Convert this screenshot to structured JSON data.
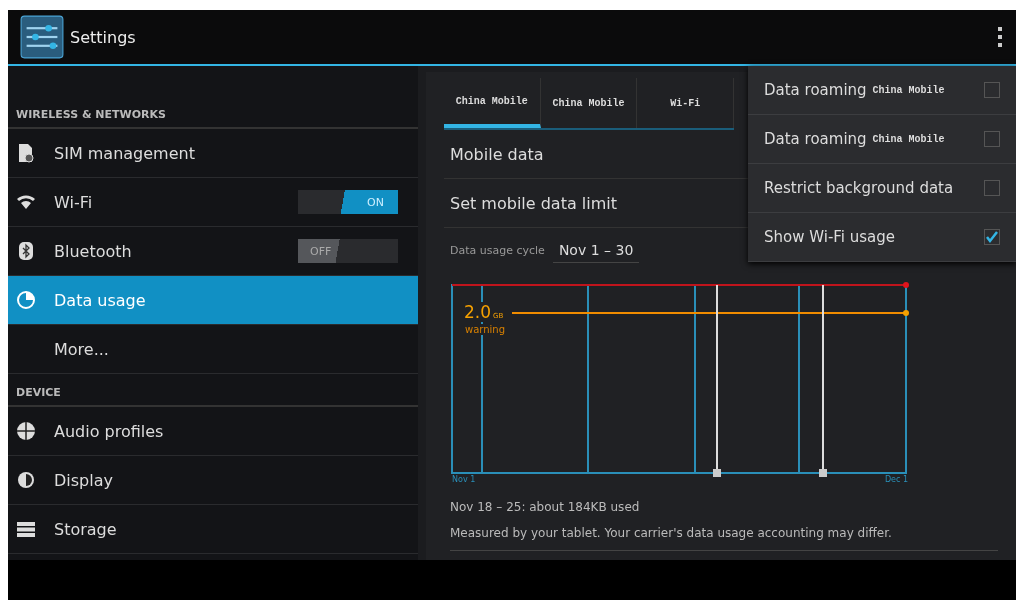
{
  "action_bar": {
    "title": "Settings"
  },
  "sidebar": {
    "sections": [
      {
        "header": "WIRELESS & NETWORKS",
        "items": [
          {
            "label": "SIM management",
            "kind": "sim",
            "selected": false
          },
          {
            "label": "Wi-Fi",
            "kind": "wifi",
            "selected": false,
            "switch": {
              "on": true,
              "label": "ON"
            }
          },
          {
            "label": "Bluetooth",
            "kind": "bluetooth",
            "selected": false,
            "switch": {
              "on": false,
              "label": "OFF"
            }
          },
          {
            "label": "Data usage",
            "kind": "data",
            "selected": true
          },
          {
            "label": "More...",
            "kind": "plain",
            "selected": false
          }
        ]
      },
      {
        "header": "DEVICE",
        "items": [
          {
            "label": "Audio profiles",
            "kind": "audio",
            "selected": false
          },
          {
            "label": "Display",
            "kind": "display",
            "selected": false
          },
          {
            "label": "Storage",
            "kind": "storage",
            "selected": false
          }
        ]
      }
    ]
  },
  "tabs": [
    {
      "label": "China Mobile",
      "selected": true
    },
    {
      "label": "China Mobile",
      "selected": false
    },
    {
      "label": "Wi-Fi",
      "selected": false
    }
  ],
  "rows": [
    "Mobile data",
    "Set mobile data limit"
  ],
  "cycle": {
    "label": "Data usage cycle",
    "value": "Nov 1 – 30"
  },
  "chart": {
    "warning_value": "2.0",
    "warning_unit": "GB",
    "warning_label": "warning",
    "start_label": "Nov 1",
    "end_label": "Dec 1"
  },
  "summary": "Nov 18 – 25: about 184KB used",
  "note": "Measured by your tablet. Your carrier's data usage accounting may differ.",
  "menu": [
    {
      "label": "Data roaming",
      "carrier": "China Mobile",
      "checked": false
    },
    {
      "label": "Data roaming",
      "carrier": "China Mobile",
      "checked": false
    },
    {
      "label": "Restrict background data",
      "checked": false
    },
    {
      "label": "Show Wi-Fi usage",
      "checked": true
    }
  ]
}
